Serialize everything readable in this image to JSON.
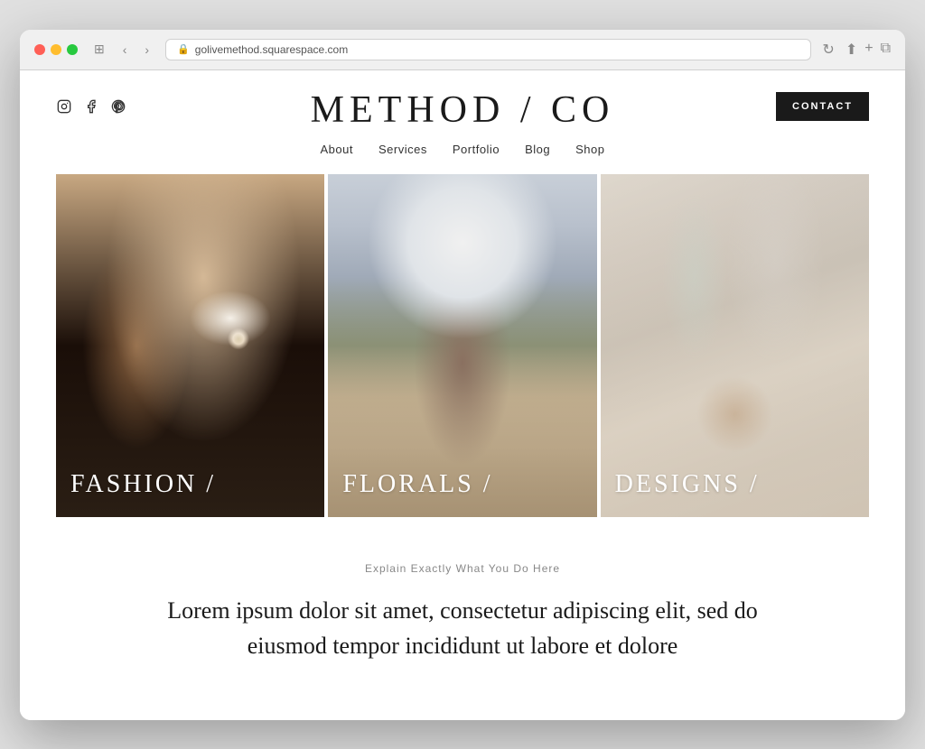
{
  "browser": {
    "url": "golivemethod.squarespace.com",
    "refresh_icon": "↻",
    "back_icon": "‹",
    "forward_icon": "›",
    "share_icon": "⬆",
    "add_tab_icon": "+",
    "tabs_icon": "⧉"
  },
  "header": {
    "title": "METHOD / CO",
    "contact_label": "CONTACT",
    "social": {
      "instagram": "instagram-icon",
      "facebook": "facebook-icon",
      "pinterest": "pinterest-icon"
    }
  },
  "nav": {
    "items": [
      {
        "label": "About"
      },
      {
        "label": "Services"
      },
      {
        "label": "Portfolio"
      },
      {
        "label": "Blog"
      },
      {
        "label": "Shop"
      }
    ]
  },
  "gallery": {
    "items": [
      {
        "label": "FASHION /",
        "alt": "Woman with earring"
      },
      {
        "label": "FLORALS /",
        "alt": "Hands holding white flower"
      },
      {
        "label": "DESIGNS /",
        "alt": "Glasses and macarons on table"
      }
    ]
  },
  "section": {
    "subtitle": "Explain Exactly What You Do Here",
    "body": "Lorem ipsum dolor sit amet, consectetur adipiscing elit, sed do eiusmod tempor incididunt ut labore et dolore"
  }
}
